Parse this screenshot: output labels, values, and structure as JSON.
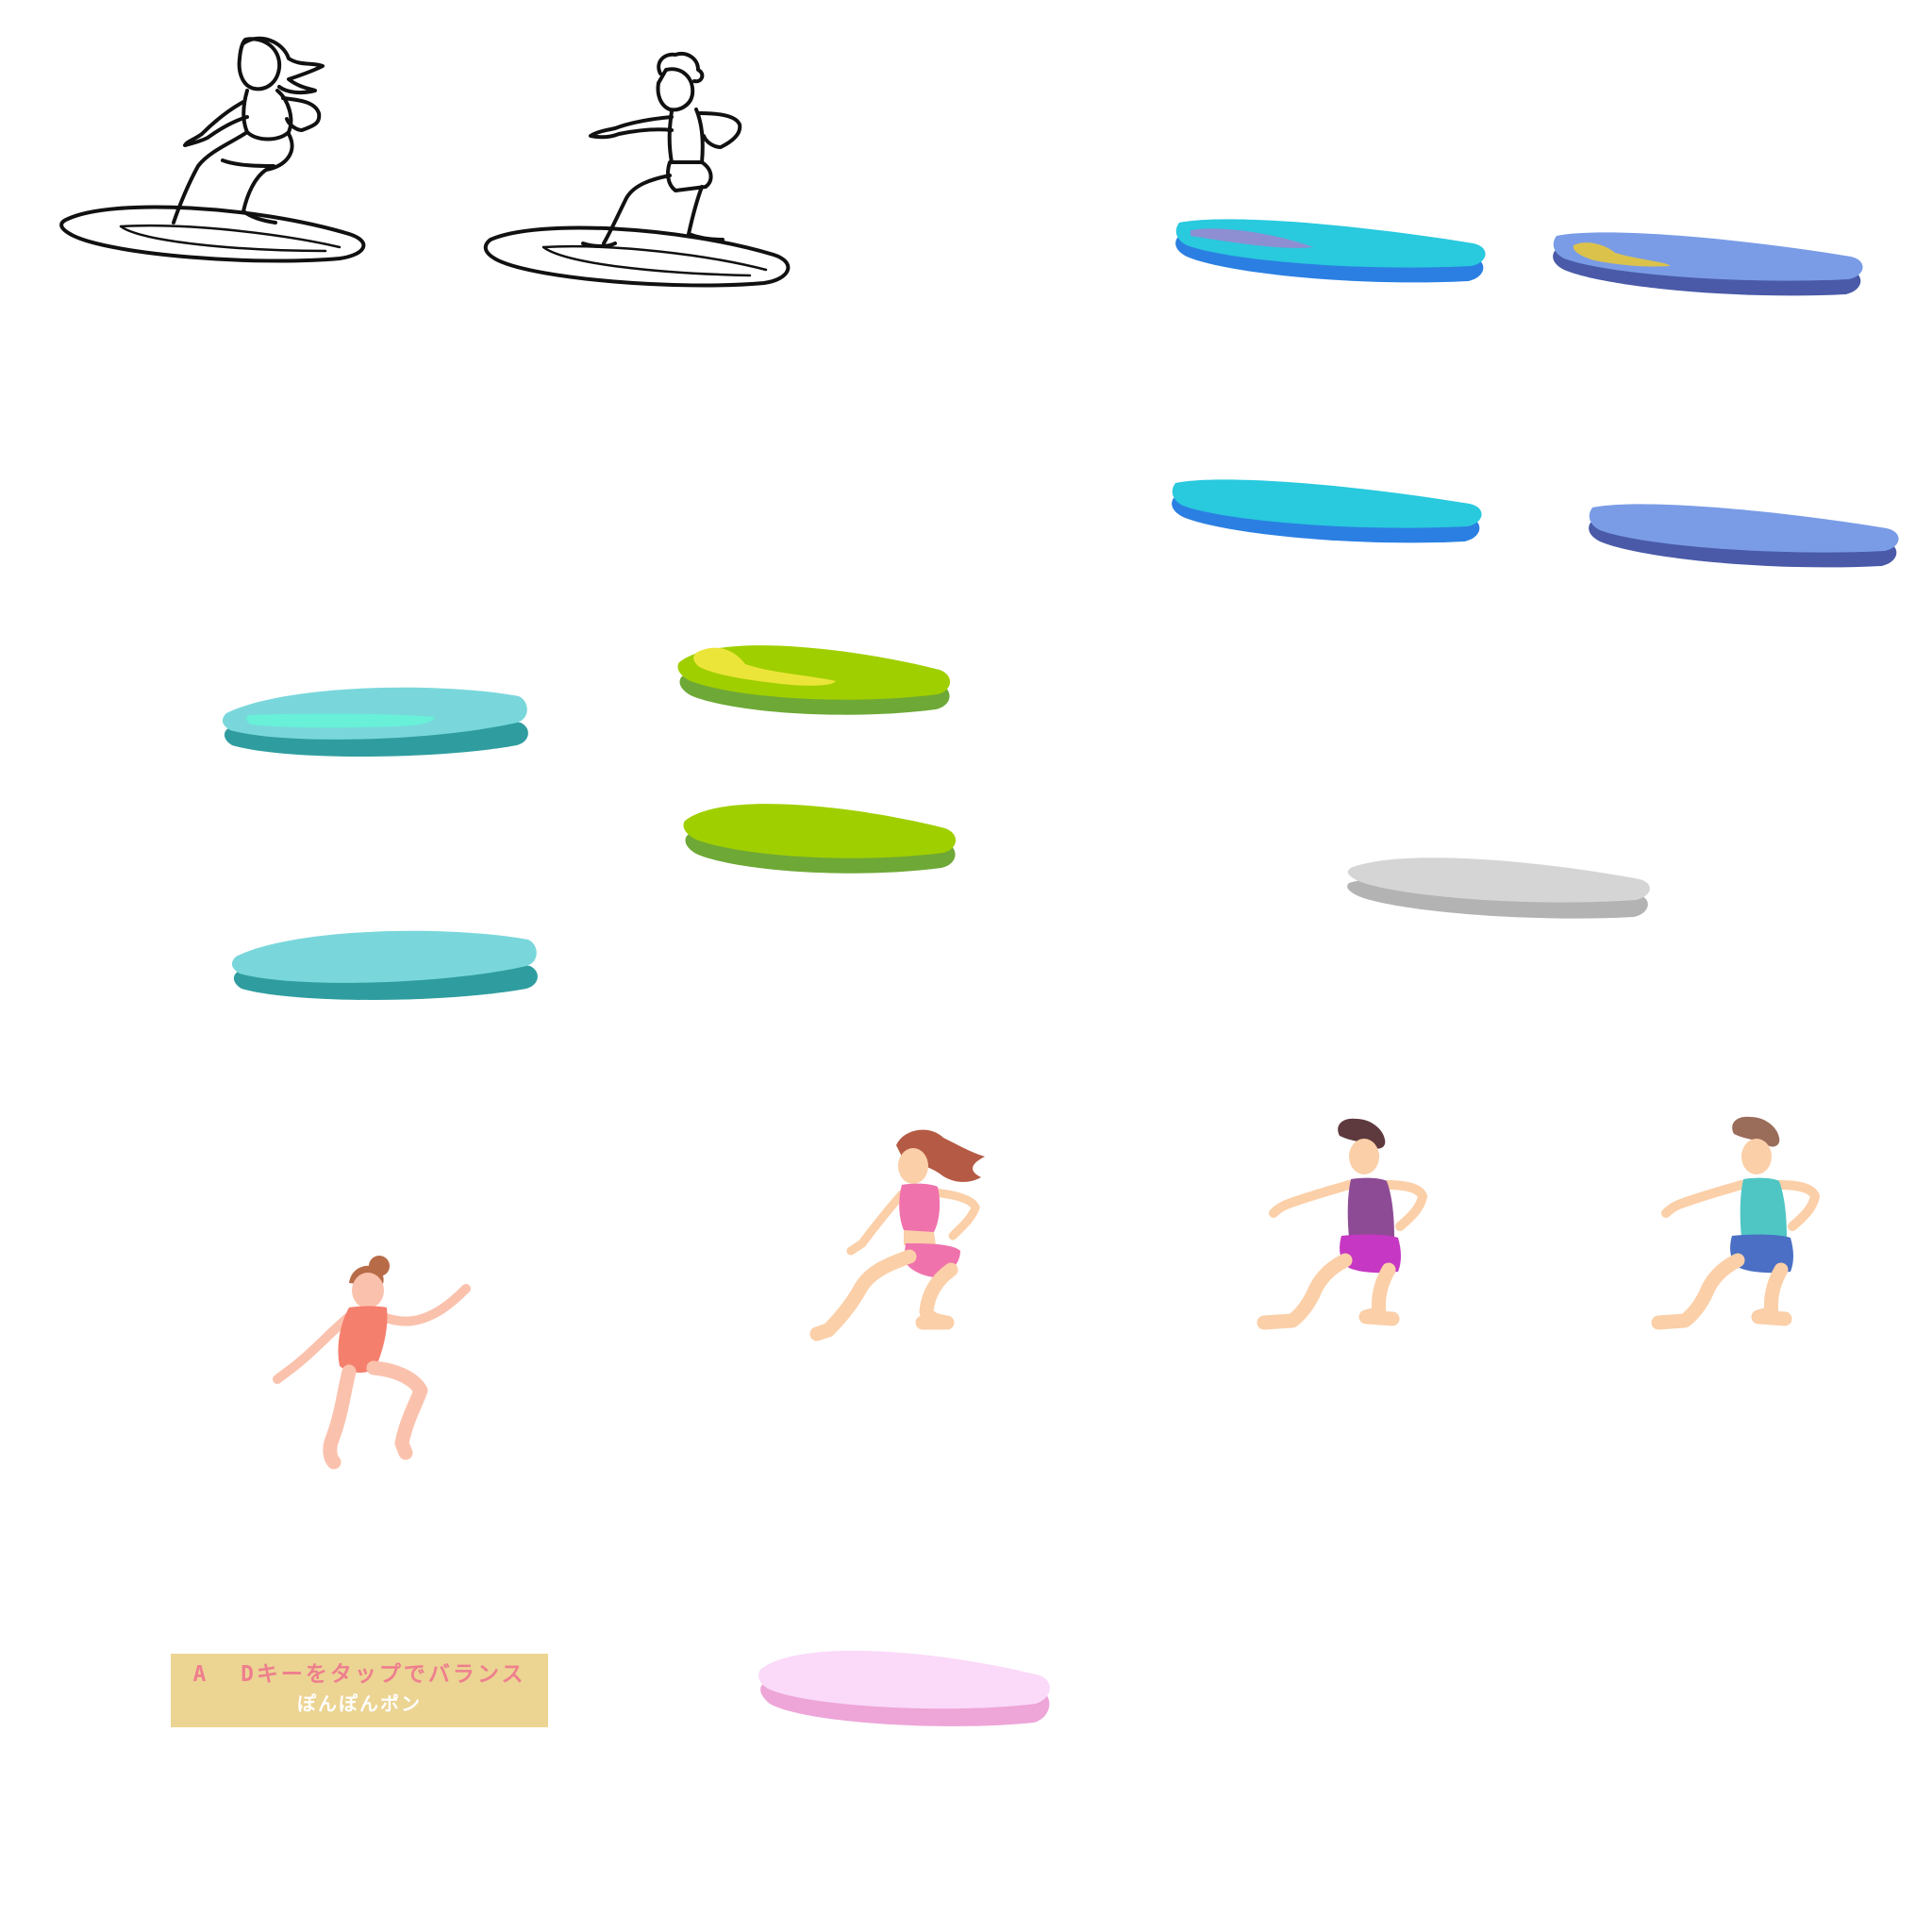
{
  "hint": {
    "line1": "A  Dキーをタップでバランス",
    "line2": "ぽんぽんポン"
  },
  "palette": {
    "skin": "#fbcfa8",
    "skin_child": "#fac2ad",
    "outline": "#111111",
    "board_cyan_top": "#29c9de",
    "board_cyan_side": "#2b7fe2",
    "board_periwinkle_top": "#7a9ce6",
    "board_periwinkle_side": "#4a5aa8",
    "board_teal_top": "#79d7db",
    "board_teal_side": "#2f9d9f",
    "board_teal_stripe": "#68f0d8",
    "board_lime_top": "#a0cf00",
    "board_lime_side": "#6ea836",
    "board_lime_stripe": "#ece539",
    "board_gray_top": "#d5d5d5",
    "board_gray_side": "#b3b3b3",
    "board_pink_top": "#fad9f9",
    "board_pink_side": "#eea5d8",
    "stripe_violet": "#8d8fd2",
    "stripe_gold": "#dbc24b",
    "hair_auburn": "#b55a44",
    "hair_brown": "#b86b47",
    "hair_dark": "#5e3a3f",
    "hair_cocoa": "#9a6c5a",
    "swimsuit_coral": "#f57f6d",
    "top_pink": "#ef72ad",
    "bottom_pink": "#ef72ad",
    "tank_purple": "#8e4b95",
    "shorts_magenta": "#c637c3",
    "tank_teal": "#4fc6c4",
    "shorts_blue": "#4a6fc4"
  }
}
